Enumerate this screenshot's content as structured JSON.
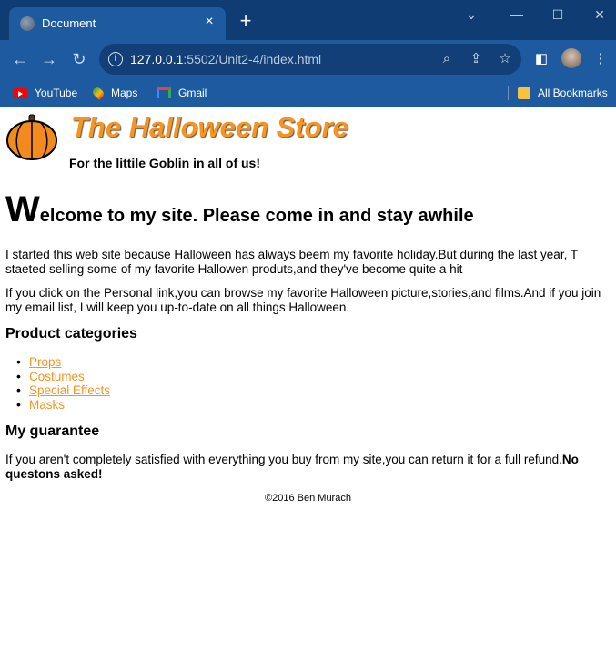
{
  "browser": {
    "tab_title": "Document",
    "url_host": "127.0.0.1",
    "url_path": ":5502/Unit2-4/index.html",
    "bookmarks": [
      {
        "label": "YouTube",
        "icon": "youtube-icon"
      },
      {
        "label": "Maps",
        "icon": "maps-icon"
      },
      {
        "label": "Gmail",
        "icon": "gmail-icon"
      }
    ],
    "all_bookmarks_label": "All Bookmarks"
  },
  "page": {
    "title": "The Halloween Store",
    "tagline": "For the littile Goblin in all of us!",
    "welcome_initial": "W",
    "welcome_rest": "elcome to my site. Please come in and stay awhile",
    "intro_p1": "I started this web site because Halloween has always beem my favorite holiday.But during the last year, T staeted selling some of my favorite Hallowen produts,and they've become quite a hit",
    "intro_p2": "If you click on the Personal link,you can browse my favorite Halloween picture,stories,and films.And if you join my email list, I will keep you up-to-date on all things Halloween.",
    "categories_heading": "Product categories",
    "categories": [
      {
        "label": "Props",
        "link": true
      },
      {
        "label": "Costumes",
        "link": false
      },
      {
        "label": "Special Effects",
        "link": true
      },
      {
        "label": "Masks",
        "link": false
      }
    ],
    "guarantee_heading": "My guarantee",
    "guarantee_text": "If you aren't completely satisfied with everything you buy from my site,you can return it for a full refund.",
    "guarantee_bold": "No questons asked!",
    "footer": "©2016 Ben Murach"
  },
  "colors": {
    "accent_orange": "#f7941d",
    "chrome_dark": "#0f3d73",
    "chrome": "#1e5aa0"
  }
}
